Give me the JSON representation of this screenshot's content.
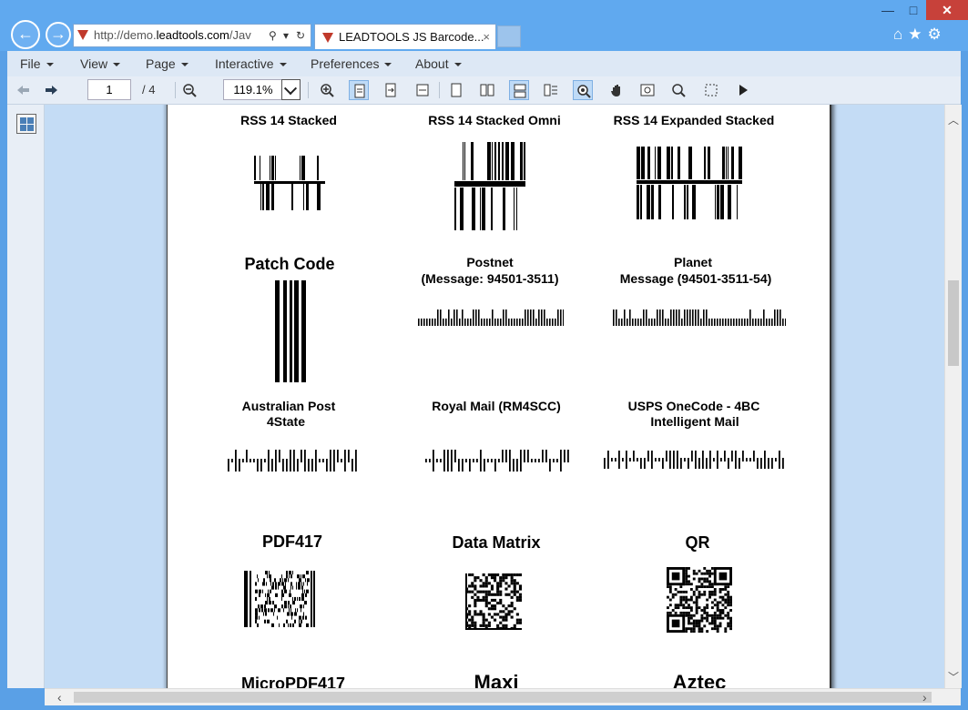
{
  "browser": {
    "url_prefix": "http://demo.",
    "url_domain": "leadtools.com",
    "url_rest": "/Jav",
    "tab_title": "LEADTOOLS JS Barcode...",
    "tab_close": "×",
    "back_glyph": "←",
    "forward_glyph": "→",
    "minimize": "—",
    "maximize": "□",
    "close": "✕",
    "home": "⌂",
    "favorites": "★",
    "settings": "⚙",
    "search_glyph": "⚲",
    "dropdown_glyph": "▾",
    "refresh_glyph": "↻"
  },
  "menu": {
    "items": [
      {
        "label": "File"
      },
      {
        "label": "View"
      },
      {
        "label": "Page"
      },
      {
        "label": "Interactive"
      },
      {
        "label": "Preferences"
      },
      {
        "label": "About"
      }
    ]
  },
  "toolbar": {
    "page_value": "1",
    "page_count": "/ 4",
    "zoom_value": "119.1%"
  },
  "document": {
    "labels": [
      {
        "text": "RSS 14 Stacked"
      },
      {
        "text": "RSS 14 Stacked Omni"
      },
      {
        "text": "RSS 14 Expanded Stacked"
      },
      {
        "text": "Patch Code"
      },
      {
        "text": "Postnet"
      },
      {
        "text": "(Message: 94501-3511)"
      },
      {
        "text": "Planet"
      },
      {
        "text": "Message (94501-3511-54)"
      },
      {
        "text": "Australian Post"
      },
      {
        "text": "4State"
      },
      {
        "text": "Royal Mail (RM4SCC)"
      },
      {
        "text": "USPS OneCode - 4BC"
      },
      {
        "text": "Intelligent Mail"
      },
      {
        "text": "PDF417"
      },
      {
        "text": "Data Matrix"
      },
      {
        "text": "QR"
      },
      {
        "text": "MicroPDF417"
      },
      {
        "text": "Maxi"
      },
      {
        "text": "Aztec"
      }
    ]
  },
  "colors": {
    "window_frame": "#5aa0e6",
    "viewer_bg": "#c4dcf5",
    "active_tool": "#bfdbf7",
    "close_button": "#c7413a"
  }
}
